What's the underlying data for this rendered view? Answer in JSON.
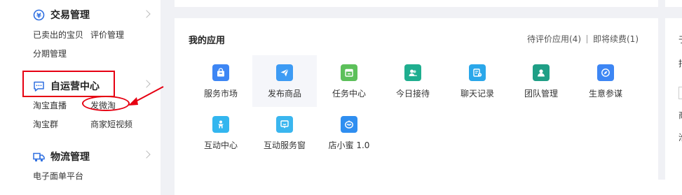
{
  "sidebar": {
    "trade": {
      "title": "交易管理",
      "links": [
        "已卖出的宝贝",
        "评价管理",
        "分期管理"
      ]
    },
    "self_operated": {
      "title": "自运营中心",
      "links": [
        "淘宝直播",
        "发微淘",
        "淘宝群",
        "商家短视频"
      ]
    },
    "logistics": {
      "title": "物流管理",
      "links": [
        "电子面单平台"
      ]
    }
  },
  "apps": {
    "title": "我的应用",
    "pending_review": "待评价应用(4)",
    "renewal": "即将续费(1)",
    "items": [
      {
        "label": "服务市场",
        "icon": "shopping-bag-icon",
        "color": "#3d86f4"
      },
      {
        "label": "发布商品",
        "icon": "paper-plane-icon",
        "color": "#3d9bf4"
      },
      {
        "label": "任务中心",
        "icon": "calendar-icon",
        "color": "#5cc05a"
      },
      {
        "label": "今日接待",
        "icon": "users-icon",
        "color": "#1fae8f"
      },
      {
        "label": "聊天记录",
        "icon": "chat-record-icon",
        "color": "#2aa7ea"
      },
      {
        "label": "团队管理",
        "icon": "team-icon",
        "color": "#1f9f86"
      },
      {
        "label": "生意参谋",
        "icon": "compass-icon",
        "color": "#3d86f4"
      },
      {
        "label": "互动中心",
        "icon": "person-interact-icon",
        "color": "#33b6ef"
      },
      {
        "label": "互动服务窗",
        "icon": "service-window-icon",
        "color": "#3ab6ef"
      },
      {
        "label": "店小蜜 1.0",
        "icon": "robot-icon",
        "color": "#2f8ef0"
      }
    ]
  },
  "right_panel": {
    "chars": [
      "于",
      "指",
      "商",
      "淮"
    ]
  },
  "colors": {
    "highlight": "#e60012",
    "page_bg": "#f0f1f5"
  }
}
